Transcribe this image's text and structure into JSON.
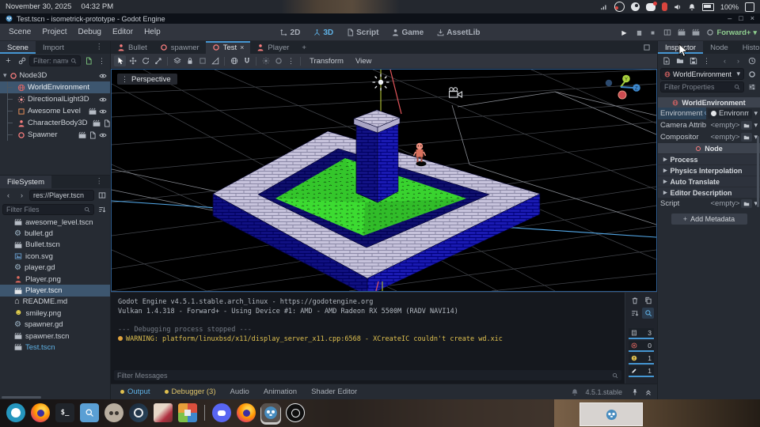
{
  "system_bar": {
    "date": "November 30, 2025",
    "time": "04:32 PM",
    "battery_percent": "100%",
    "tray_icons": [
      "network-signal",
      "obs",
      "steam",
      "discord",
      "microphone",
      "volume",
      "notifications",
      "battery",
      "keyboard-layout"
    ]
  },
  "title_bar": {
    "title": "Test.tscn - isometrick-prototype - Godot Engine"
  },
  "menu_bar": {
    "menus": [
      "Scene",
      "Project",
      "Debug",
      "Editor",
      "Help"
    ],
    "workspaces": [
      "2D",
      "3D",
      "Script",
      "Game",
      "AssetLib"
    ],
    "active_workspace": "3D",
    "renderer": "Forward+"
  },
  "scene_dock": {
    "tabs": [
      "Scene",
      "Import"
    ],
    "active_tab": "Scene",
    "filter_placeholder": "Filter: name, t:t",
    "tree": [
      {
        "name": "Node3D"
      },
      {
        "name": "WorldEnvironment",
        "selected": true
      },
      {
        "name": "DirectionalLight3D"
      },
      {
        "name": "Awesome Level"
      },
      {
        "name": "CharacterBody3D"
      },
      {
        "name": "Spawner"
      }
    ]
  },
  "filesystem_dock": {
    "tab": "FileSystem",
    "path": "res://Player.tscn",
    "filter_placeholder": "Filter Files",
    "files": [
      {
        "name": "awesome_level.tscn"
      },
      {
        "name": "bullet.gd"
      },
      {
        "name": "Bullet.tscn"
      },
      {
        "name": "icon.svg"
      },
      {
        "name": "player.gd"
      },
      {
        "name": "Player.png"
      },
      {
        "name": "Player.tscn",
        "selected": true
      },
      {
        "name": "README.md"
      },
      {
        "name": "smiley.png"
      },
      {
        "name": "spawner.gd"
      },
      {
        "name": "spawner.tscn"
      },
      {
        "name": "Test.tscn",
        "open": true
      }
    ]
  },
  "scene_tabs": {
    "tabs": [
      "Bullet",
      "spawner",
      "Test",
      "Player"
    ],
    "active_tab": "Test"
  },
  "viewport": {
    "perspective_label": "Perspective",
    "transform_menu": "Transform",
    "view_menu": "View"
  },
  "output_panel": {
    "lines": [
      "Godot Engine v4.5.1.stable.arch_linux - https://godotengine.org",
      "Vulkan 1.4.318 - Forward+ - Using Device #1: AMD - AMD Radeon RX 5500M (RADV NAVI14)",
      "--- Debugging process stopped ---",
      "WARNING: platform/linuxbsd/x11/display_server_x11.cpp:6568 - XCreateIC couldn't create wd.xic"
    ],
    "filter_placeholder": "Filter Messages",
    "counts": [
      {
        "label": "all-messages",
        "value": "3"
      },
      {
        "label": "errors",
        "value": "0"
      },
      {
        "label": "warnings",
        "value": "1"
      },
      {
        "label": "editor-messages",
        "value": "1"
      }
    ]
  },
  "bottom_bar": {
    "tabs": [
      "Output",
      "Debugger (3)",
      "Audio",
      "Animation",
      "Shader Editor"
    ],
    "active_tab": "Output",
    "version": "4.5.1.stable"
  },
  "inspector": {
    "tabs": [
      "Inspector",
      "Node",
      "History"
    ],
    "active_tab": "Inspector",
    "node_name": "WorldEnvironment",
    "filter_placeholder": "Filter Properties",
    "category_resource": "WorldEnvironment",
    "category_node": "Node",
    "properties": [
      {
        "label": "Environment",
        "value": "Environm"
      },
      {
        "label": "Camera Attribut",
        "value": "<empty>"
      },
      {
        "label": "Compositor",
        "value": "<empty>"
      }
    ],
    "groups": [
      "Process",
      "Physics Interpolation",
      "Auto Translate",
      "Editor Description"
    ],
    "script_label": "Script",
    "script_value": "<empty>",
    "add_metadata_label": "Add Metadata"
  },
  "taskbar": {
    "apps": [
      "app-launcher",
      "firefox",
      "terminal",
      "file-search",
      "gimp",
      "steam",
      "art-window",
      "package-cube",
      "discord",
      "firefox-2",
      "godot",
      "obs"
    ],
    "preview": "godot-window-preview"
  },
  "icons": {
    "dots": "⋮",
    "chevron_down": "▾",
    "chevron_right": "▸",
    "nav_left": "‹",
    "nav_right": "›",
    "close": "×",
    "minimize": "–",
    "maximize": "□",
    "play": "▶",
    "pause": "▮▮",
    "stop": "■",
    "plus": "+",
    "gear": "⚙",
    "house": "⌂",
    "smiley": "☻",
    "revert": "↺",
    "terminal_prompt": "$_"
  },
  "colors": {
    "accent": "#4596d2",
    "warning": "#e0c04f",
    "node_red": "#fc7f7f",
    "renderer_green": "#8fce8f",
    "selected_row": "#3d566f",
    "open_scene_blue": "#5fb2e6"
  }
}
